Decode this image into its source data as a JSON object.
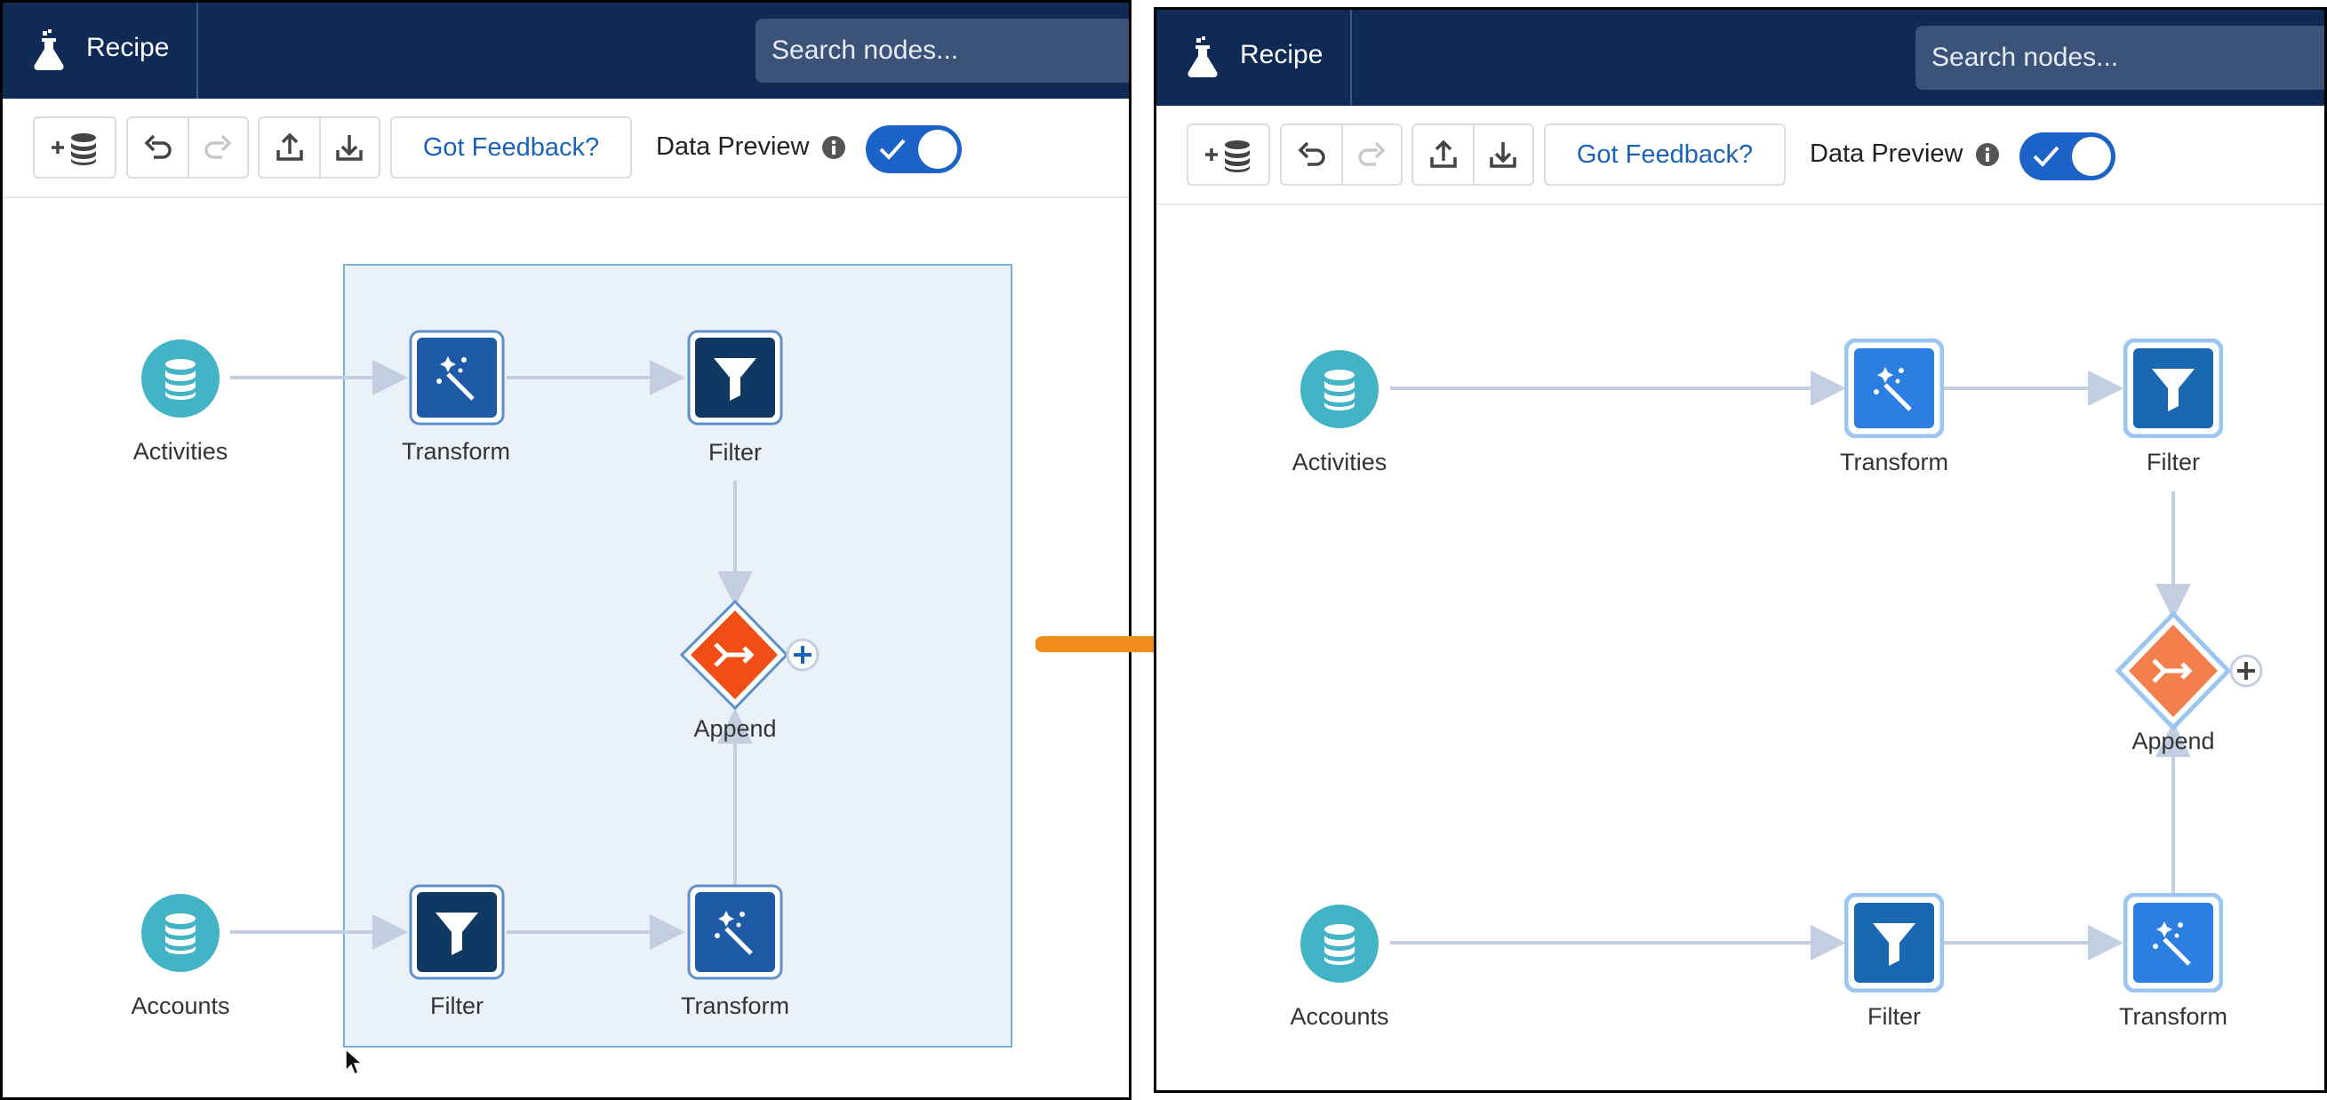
{
  "app": {
    "title": "Recipe"
  },
  "search": {
    "placeholder": "Search nodes..."
  },
  "toolbar": {
    "feedback_label": "Got Feedback?",
    "data_preview_label": "Data Preview",
    "data_preview_enabled": true
  },
  "icons": {
    "add_data": "database-plus-icon",
    "undo": "undo-icon",
    "redo": "redo-icon",
    "upload": "upload-icon",
    "download": "download-icon",
    "info": "info-icon",
    "flask": "flask-icon"
  },
  "colors": {
    "header": "#0e2a55",
    "input_node": "#43b4c6",
    "transform_before": "#1f5aa6",
    "transform_after": "#2c7fe0",
    "filter_before": "#0f3862",
    "filter_after": "#1b68b2",
    "append_before": "#f04e14",
    "append_after": "#f27f4c",
    "selection": "#eaf1f8",
    "arrow": "#f28c1a"
  },
  "graph": {
    "nodes": {
      "activities": {
        "label": "Activities",
        "type": "input"
      },
      "accounts": {
        "label": "Accounts",
        "type": "input"
      },
      "transform_top": {
        "label": "Transform",
        "type": "transform"
      },
      "filter_top": {
        "label": "Filter",
        "type": "filter"
      },
      "append": {
        "label": "Append",
        "type": "append"
      },
      "filter_bottom": {
        "label": "Filter",
        "type": "filter"
      },
      "transform_bottom": {
        "label": "Transform",
        "type": "transform"
      }
    }
  }
}
